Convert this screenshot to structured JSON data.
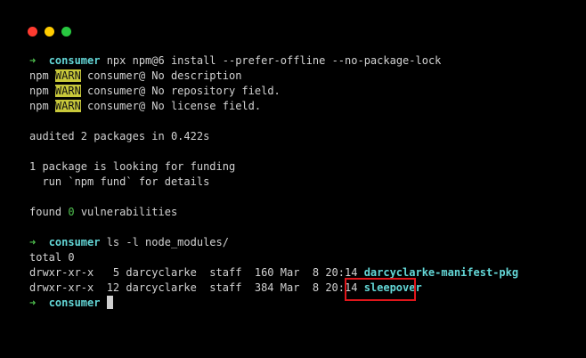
{
  "window": {
    "controls": [
      {
        "name": "close",
        "color": "#ff3b30"
      },
      {
        "name": "minimize",
        "color": "#ffcc00"
      },
      {
        "name": "maximize",
        "color": "#28c840"
      }
    ]
  },
  "terminal": {
    "lines": [
      [
        {
          "t": "➜  ",
          "c": "arrow"
        },
        {
          "t": "consumer",
          "c": "dir"
        },
        {
          "t": " npx npm@6 install --prefer-offline --no-package-lock"
        }
      ],
      [
        {
          "t": "npm "
        },
        {
          "t": "WARN",
          "c": "warn"
        },
        {
          "t": " consumer@ No description"
        }
      ],
      [
        {
          "t": "npm "
        },
        {
          "t": "WARN",
          "c": "warn"
        },
        {
          "t": " consumer@ No repository field."
        }
      ],
      [
        {
          "t": "npm "
        },
        {
          "t": "WARN",
          "c": "warn"
        },
        {
          "t": " consumer@ No license field."
        }
      ],
      [],
      [
        {
          "t": "audited 2 packages in 0.422s"
        }
      ],
      [],
      [
        {
          "t": "1 package is looking for funding"
        }
      ],
      [
        {
          "t": "  run `npm fund` for details"
        }
      ],
      [],
      [
        {
          "t": "found "
        },
        {
          "t": "0",
          "c": "num"
        },
        {
          "t": " vulnerabilities"
        }
      ],
      [],
      [
        {
          "t": "➜  ",
          "c": "arrow"
        },
        {
          "t": "consumer",
          "c": "dir"
        },
        {
          "t": " ls -l node_modules/"
        }
      ],
      [
        {
          "t": "total 0"
        }
      ],
      [
        {
          "t": "drwxr-xr-x   5 darcyclarke  staff  160 Mar  8 20:14 "
        },
        {
          "t": "darcyclarke-manifest-pkg",
          "c": "dir"
        }
      ],
      [
        {
          "t": "drwxr-xr-x  12 darcyclarke  staff  384 Mar  8 20:14 "
        },
        {
          "t": "sleepover",
          "c": "dir"
        }
      ],
      [
        {
          "t": "➜  ",
          "c": "arrow"
        },
        {
          "t": "consumer",
          "c": "dir"
        },
        {
          "t": " "
        },
        {
          "t": "",
          "c": "cursor"
        }
      ]
    ]
  },
  "highlight": {
    "target": "sleepover",
    "color": "#e0161b"
  }
}
